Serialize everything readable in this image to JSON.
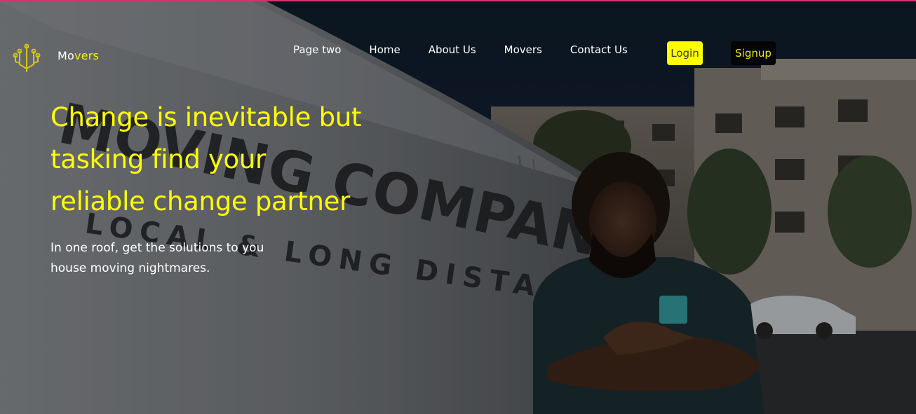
{
  "brand": {
    "name_part1": "Mo",
    "name_part2": "vers"
  },
  "nav": {
    "items": [
      {
        "label": "Page two"
      },
      {
        "label": "Home"
      },
      {
        "label": "About Us"
      },
      {
        "label": "Movers"
      },
      {
        "label": "Contact Us"
      }
    ],
    "login_label": "Login",
    "signup_label": "Signup"
  },
  "hero": {
    "headline_lines": [
      "Change is inevitable but",
      "tasking find your",
      "reliable change partner"
    ],
    "subtext_lines": [
      "In one roof, get the solutions to you",
      "house moving nightmares."
    ]
  },
  "background": {
    "van_text_line1": "MOVING COMPANY",
    "van_text_line2": "LOCAL & LONG DISTANCE"
  },
  "colors": {
    "accent": "#ffff00",
    "top_border": "#d6336c",
    "login_bg": "#ffff00",
    "signup_bg": "#050505"
  },
  "icons": {
    "logo": "circuit-tree-icon"
  }
}
